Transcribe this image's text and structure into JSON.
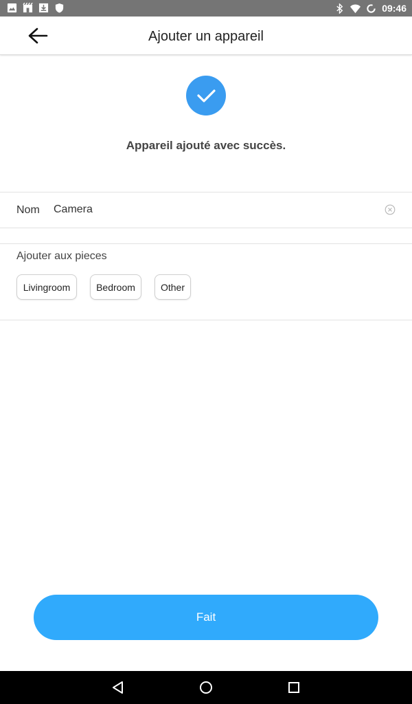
{
  "status_bar": {
    "time": "09:46",
    "left_icons": [
      "image-icon",
      "store-icon",
      "download-icon",
      "shield-icon"
    ],
    "right_icons": [
      "bluetooth-icon",
      "wifi-icon",
      "sync-icon"
    ]
  },
  "app_bar": {
    "title": "Ajouter un appareil",
    "back_icon": "arrow-left-icon"
  },
  "success": {
    "icon": "check-circle-icon",
    "message": "Appareil ajouté avec succès.",
    "color": "#3a9cf0"
  },
  "name_field": {
    "label": "Nom",
    "value": "Camera",
    "clear_icon": "clear-circle-icon"
  },
  "rooms": {
    "label": "Ajouter aux pieces",
    "options": [
      "Livingroom",
      "Bedroom",
      "Other"
    ]
  },
  "done_button": {
    "label": "Fait",
    "color": "#30aafc"
  },
  "nav_bar": {
    "icons": [
      "nav-back-icon",
      "nav-home-icon",
      "nav-recents-icon"
    ]
  }
}
